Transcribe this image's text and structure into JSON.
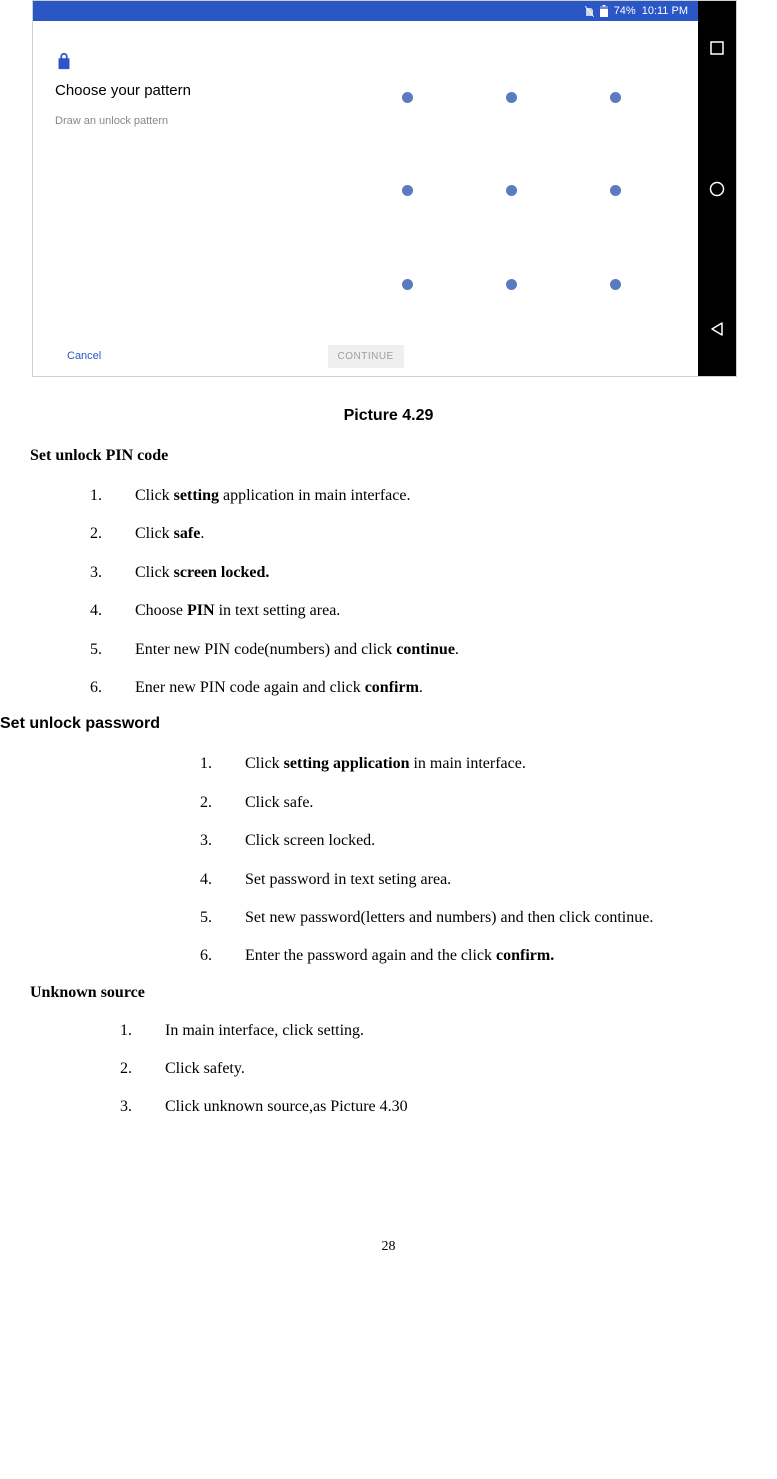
{
  "screenshot": {
    "statusbar": {
      "battery": "74%",
      "time": "10:11 PM"
    },
    "title": "Choose your pattern",
    "subtitle": "Draw an unlock pattern",
    "cancel": "Cancel",
    "cont": "CONTINUE"
  },
  "caption": "Picture 4.29",
  "section_pin": {
    "title": "Set unlock PIN code",
    "items": [
      {
        "n": "1.",
        "pre": "Click ",
        "b": "setting",
        "post": " application in main interface."
      },
      {
        "n": "2.",
        "pre": "Click ",
        "b": "safe",
        "post": "."
      },
      {
        "n": "3.",
        "pre": "Click ",
        "b": "screen locked.",
        "post": ""
      },
      {
        "n": "4.",
        "pre": "Choose ",
        "b": "PIN",
        "post": " in text setting area."
      },
      {
        "n": "5.",
        "pre": "Enter new PIN code(numbers) and click ",
        "b": "continue",
        "post": "."
      },
      {
        "n": "6.",
        "pre": "Ener new PIN code again and click ",
        "b": "confirm",
        "post": "."
      }
    ]
  },
  "section_pwd": {
    "title": "Set unlock password",
    "items": [
      {
        "n": "1.",
        "pre": "Click ",
        "b": "setting application",
        "post": " in main interface."
      },
      {
        "n": "2.",
        "pre": "Click safe.",
        "b": "",
        "post": ""
      },
      {
        "n": "3.",
        "pre": "Click screen locked.",
        "b": "",
        "post": ""
      },
      {
        "n": "4.",
        "pre": "Set password in text seting area.",
        "b": "",
        "post": ""
      },
      {
        "n": "5.",
        "pre": "Set new password(letters and numbers) and then click continue.",
        "b": "",
        "post": ""
      },
      {
        "n": "6.",
        "pre": "Enter the password again and the click ",
        "b": "confirm.",
        "post": ""
      }
    ]
  },
  "section_unknown": {
    "title": "Unknown source",
    "items": [
      {
        "n": "1.",
        "txt": "In main interface, click setting."
      },
      {
        "n": "2.",
        "txt": "Click safety."
      },
      {
        "n": "3.",
        "txt": "Click unknown source,as Picture 4.30"
      }
    ]
  },
  "page_number": "28"
}
